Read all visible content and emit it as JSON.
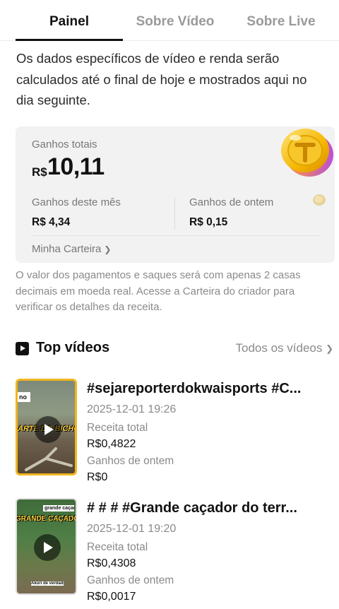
{
  "tabs": [
    {
      "label": "Painel",
      "active": true
    },
    {
      "label": "Sobre Vídeo",
      "active": false
    },
    {
      "label": "Sobre Live",
      "active": false
    }
  ],
  "notice": "Os dados específicos de vídeo e renda serão calculados até o final de hoje e mostrados aqui no dia seguinte.",
  "earnings": {
    "total_label": "Ganhos totais",
    "currency": "R$",
    "total_value": "10,11",
    "month_label": "Ganhos deste mês",
    "month_value": "R$ 4,34",
    "yesterday_label": "Ganhos de ontem",
    "yesterday_value": "R$ 0,15",
    "wallet_label": "Minha Carteira",
    "coin_icon": "gold-coin-icon"
  },
  "disclaimer": "O valor dos pagamentos e saques será com apenas 2 casas decimais em moeda real. Acesse a Carteira do criador para verificar os detalhes da receita.",
  "top_videos": {
    "title": "Top vídeos",
    "all_label": "Todos os vídeos",
    "items": [
      {
        "title": "#sejareporterdokwaisports #C...",
        "date": "2025-12-01 19:26",
        "revenue_label": "Receita total",
        "revenue": "R$0,4822",
        "yesterday_label": "Ganhos de ontem",
        "yesterday": "R$0",
        "thumb_text": "ARTE DO BICHO",
        "thumb_corner": "no"
      },
      {
        "title": "# # # #Grande caçador do terr...",
        "date": "2025-12-01 19:20",
        "revenue_label": "Receita total",
        "revenue": "R$0,4308",
        "yesterday_label": "Ganhos de ontem",
        "yesterday": "R$0,0017",
        "thumb_text": "GRANDE CAÇADOR",
        "thumb_corner": "grande caçador",
        "thumb_footer": "Akuri de verdade"
      }
    ]
  },
  "colors": {
    "accent": "#111111",
    "card_bg": "#f2f2f2",
    "muted": "#8a8a8a",
    "thumb1_border": "#f0b61e"
  }
}
